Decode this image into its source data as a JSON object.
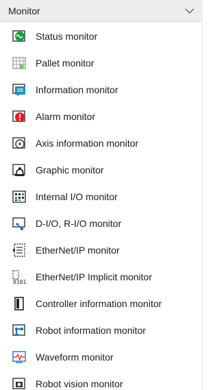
{
  "panel": {
    "title": "Monitor",
    "items": [
      {
        "label": "Status monitor",
        "icon": "status-monitor-icon"
      },
      {
        "label": "Pallet monitor",
        "icon": "pallet-monitor-icon"
      },
      {
        "label": "Information monitor",
        "icon": "information-monitor-icon"
      },
      {
        "label": "Alarm monitor",
        "icon": "alarm-monitor-icon"
      },
      {
        "label": "Axis information monitor",
        "icon": "axis-information-monitor-icon"
      },
      {
        "label": "Graphic monitor",
        "icon": "graphic-monitor-icon"
      },
      {
        "label": "Internal I/O monitor",
        "icon": "internal-io-monitor-icon"
      },
      {
        "label": "D-I/O, R-I/O monitor",
        "icon": "d-io-r-io-monitor-icon"
      },
      {
        "label": "EtherNet/IP monitor",
        "icon": "ethernet-ip-monitor-icon"
      },
      {
        "label": "EtherNet/IP Implicit monitor",
        "icon": "ethernet-ip-implicit-monitor-icon"
      },
      {
        "label": "Controller information monitor",
        "icon": "controller-information-monitor-icon"
      },
      {
        "label": "Robot information monitor",
        "icon": "robot-information-monitor-icon"
      },
      {
        "label": "Waveform monitor",
        "icon": "waveform-monitor-icon"
      },
      {
        "label": "Robot vision monitor",
        "icon": "robot-vision-monitor-icon"
      }
    ]
  },
  "colors": {
    "header_bg": "#eeeeee",
    "status_green": "#1a9b3c",
    "alarm_red": "#e02020",
    "accent_blue": "#1e73be",
    "waveform_red": "#d9383a"
  }
}
